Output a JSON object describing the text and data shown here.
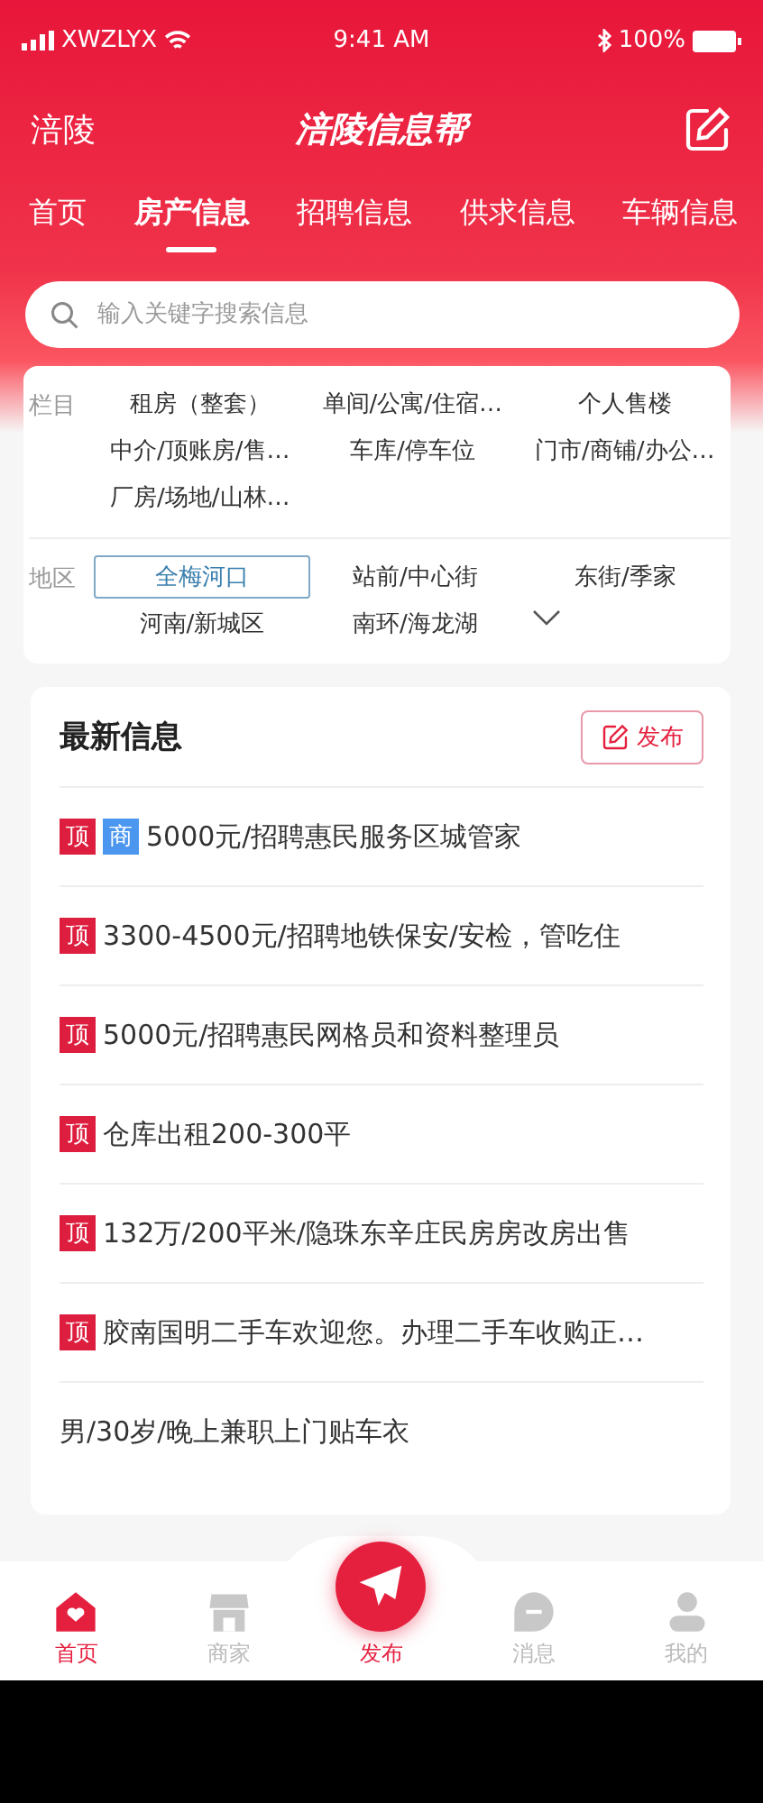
{
  "status_bar": {
    "carrier": "XWZLYX",
    "time": "9:41 AM",
    "battery": "100%"
  },
  "header": {
    "city": "涪陵",
    "title": "涪陵信息帮"
  },
  "tabs": [
    {
      "label": "首页",
      "selected": false
    },
    {
      "label": "房产信息",
      "selected": true
    },
    {
      "label": "招聘信息",
      "selected": false
    },
    {
      "label": "供求信息",
      "selected": false
    },
    {
      "label": "车辆信息",
      "selected": false
    }
  ],
  "search": {
    "placeholder": "输入关键字搜索信息"
  },
  "filters": [
    {
      "label": "栏目",
      "options": [
        {
          "label": "租房（整套）",
          "selected": false
        },
        {
          "label": "单间/公寓/住宿…",
          "selected": false
        },
        {
          "label": "个人售楼",
          "selected": false
        },
        {
          "label": "中介/顶账房/售…",
          "selected": false
        },
        {
          "label": "车库/停车位",
          "selected": false
        },
        {
          "label": "门市/商铺/办公…",
          "selected": false
        },
        {
          "label": "厂房/场地/山林…",
          "selected": false
        }
      ],
      "expandable": false
    },
    {
      "label": "地区",
      "options": [
        {
          "label": "全梅河口",
          "selected": true
        },
        {
          "label": "站前/中心街",
          "selected": false
        },
        {
          "label": "东街/季家",
          "selected": false
        },
        {
          "label": "河南/新城区",
          "selected": false
        },
        {
          "label": "南环/海龙湖",
          "selected": false
        }
      ],
      "expandable": true
    }
  ],
  "news": {
    "title": "最新信息",
    "publish_button": "发布",
    "items": [
      {
        "tags": [
          {
            "kind": "top",
            "label": "顶"
          },
          {
            "kind": "merchant",
            "label": "商"
          }
        ],
        "text": "5000元/招聘惠民服务区城管家"
      },
      {
        "tags": [
          {
            "kind": "top",
            "label": "顶"
          }
        ],
        "text": "3300-4500元/招聘地铁保安/安检，管吃住"
      },
      {
        "tags": [
          {
            "kind": "top",
            "label": "顶"
          }
        ],
        "text": "5000元/招聘惠民网格员和资料整理员"
      },
      {
        "tags": [
          {
            "kind": "top",
            "label": "顶"
          }
        ],
        "text": "仓库出租200-300平"
      },
      {
        "tags": [
          {
            "kind": "top",
            "label": "顶"
          }
        ],
        "text": "132万/200平米/隐珠东辛庄民房房改房出售"
      },
      {
        "tags": [
          {
            "kind": "top",
            "label": "顶"
          }
        ],
        "text": "胶南国明二手车欢迎您。办理二手车收购正…"
      },
      {
        "text": "男/30岁/晚上兼职上门贴车衣"
      }
    ]
  },
  "bottom_nav": [
    {
      "kind": "home",
      "label": "首页",
      "selected": true
    },
    {
      "kind": "shop",
      "label": "商家",
      "selected": false
    },
    {
      "kind": "publish",
      "label": "发布",
      "selected": false
    },
    {
      "kind": "message",
      "label": "消息",
      "selected": false
    },
    {
      "kind": "profile",
      "label": "我的",
      "selected": false
    }
  ]
}
